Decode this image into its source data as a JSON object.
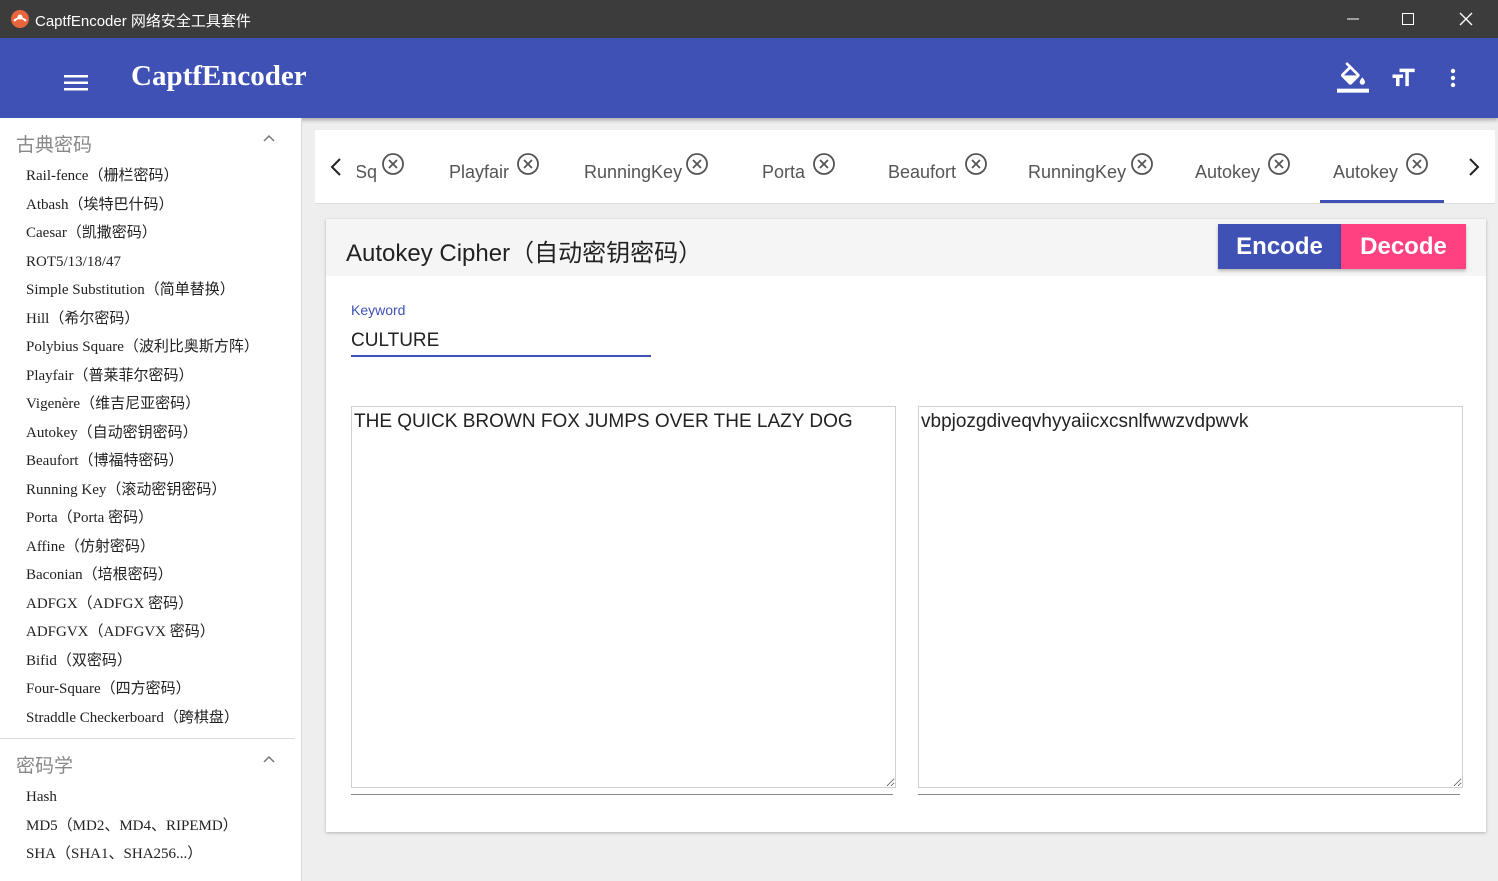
{
  "window": {
    "title": "CaptfEncoder 网络安全工具套件"
  },
  "appbar": {
    "brand": "CaptfEncoder"
  },
  "sidebar": {
    "groups": [
      {
        "title": "古典密码",
        "items": [
          "Rail-fence（栅栏密码）",
          "Atbash（埃特巴什码）",
          "Caesar（凯撒密码）",
          "ROT5/13/18/47",
          "Simple Substitution（简单替换）",
          "Hill（希尔密码）",
          "Polybius Square（波利比奥斯方阵）",
          "Playfair（普莱菲尔密码）",
          "Vigenère（维吉尼亚密码）",
          "Autokey（自动密钥密码）",
          "Beaufort（博福特密码）",
          "Running Key（滚动密钥密码）",
          "Porta（Porta 密码）",
          "Affine（仿射密码）",
          "Baconian（培根密码）",
          "ADFGX（ADFGX 密码）",
          "ADFGVX（ADFGVX 密码）",
          "Bifid（双密码）",
          "Four-Square（四方密码）",
          "Straddle Checkerboard（跨棋盘）"
        ]
      },
      {
        "title": "密码学",
        "items": [
          "Hash",
          "MD5（MD2、MD4、RIPEMD）",
          "SHA（SHA1、SHA256...）"
        ]
      }
    ]
  },
  "tabs": {
    "items": [
      "Sq",
      "Playfair",
      "RunningKey",
      "Porta",
      "Beaufort",
      "RunningKey",
      "Autokey",
      "Autokey"
    ],
    "active_index": 7
  },
  "card": {
    "title": "Autokey Cipher（自动密钥密码）",
    "encode_label": "Encode",
    "decode_label": "Decode",
    "keyword_label": "Keyword",
    "keyword_value": "CULTURE",
    "input_text": "THE QUICK BROWN FOX JUMPS OVER THE LAZY DOG",
    "output_text": "vbpjozgdiveqvhyyaiicxcsnlfwwzvdpwvk"
  },
  "colors": {
    "primary": "#3f51b5",
    "accent": "#ff4081",
    "titlebar": "#3c3c3c"
  }
}
